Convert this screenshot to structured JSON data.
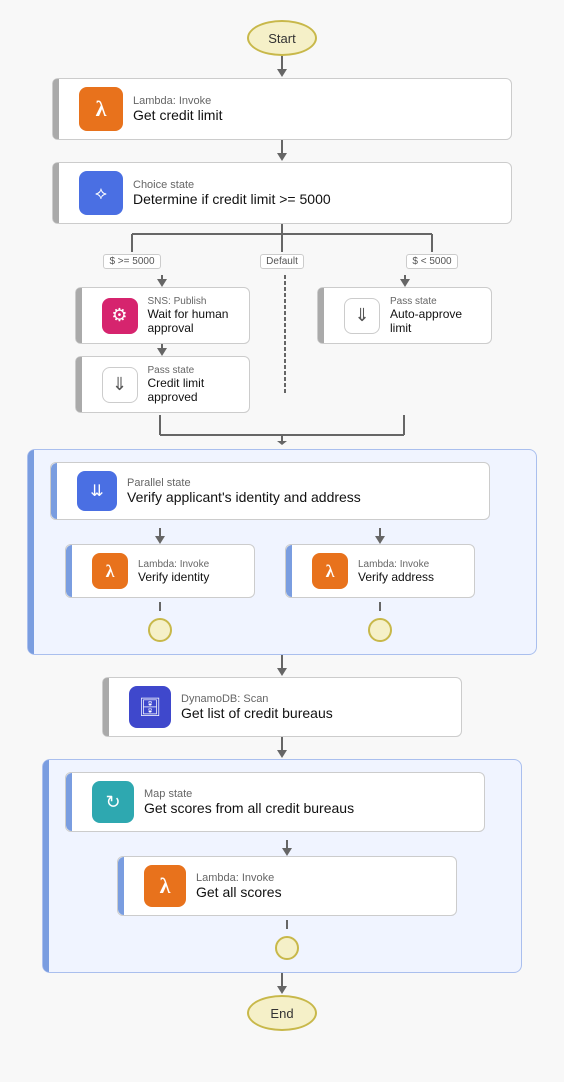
{
  "nodes": {
    "start": "Start",
    "end": "End",
    "lambda_get_credit": {
      "top_label": "Lambda: Invoke",
      "main_label": "Get credit limit"
    },
    "choice_state": {
      "top_label": "Choice state",
      "main_label": "Determine if credit limit >= 5000"
    },
    "sns_wait": {
      "top_label": "SNS: Publish",
      "main_label": "Wait for human approval"
    },
    "pass_approved": {
      "top_label": "Pass state",
      "main_label": "Credit limit approved"
    },
    "pass_auto": {
      "top_label": "Pass state",
      "main_label": "Auto-approve limit"
    },
    "parallel_state": {
      "top_label": "Parallel state",
      "main_label": "Verify applicant's identity and address"
    },
    "lambda_identity": {
      "top_label": "Lambda: Invoke",
      "main_label": "Verify identity"
    },
    "lambda_address": {
      "top_label": "Lambda: Invoke",
      "main_label": "Verify address"
    },
    "dynamodb_scan": {
      "top_label": "DynamoDB: Scan",
      "main_label": "Get list of credit bureaus"
    },
    "map_state": {
      "top_label": "Map state",
      "main_label": "Get scores from all credit bureaus"
    },
    "lambda_scores": {
      "top_label": "Lambda: Invoke",
      "main_label": "Get all scores"
    }
  },
  "branch_labels": {
    "gte5000": "$ >= 5000",
    "default": "Default",
    "lt5000": "$ < 5000"
  },
  "colors": {
    "lambda": "#e8721c",
    "sns": "#d6246e",
    "choice": "#4a6fe3",
    "pass": "#e8f5e9",
    "dynamo": "#3f48cc",
    "map": "#2ea8b0",
    "parallel": "#4a6fe3"
  }
}
